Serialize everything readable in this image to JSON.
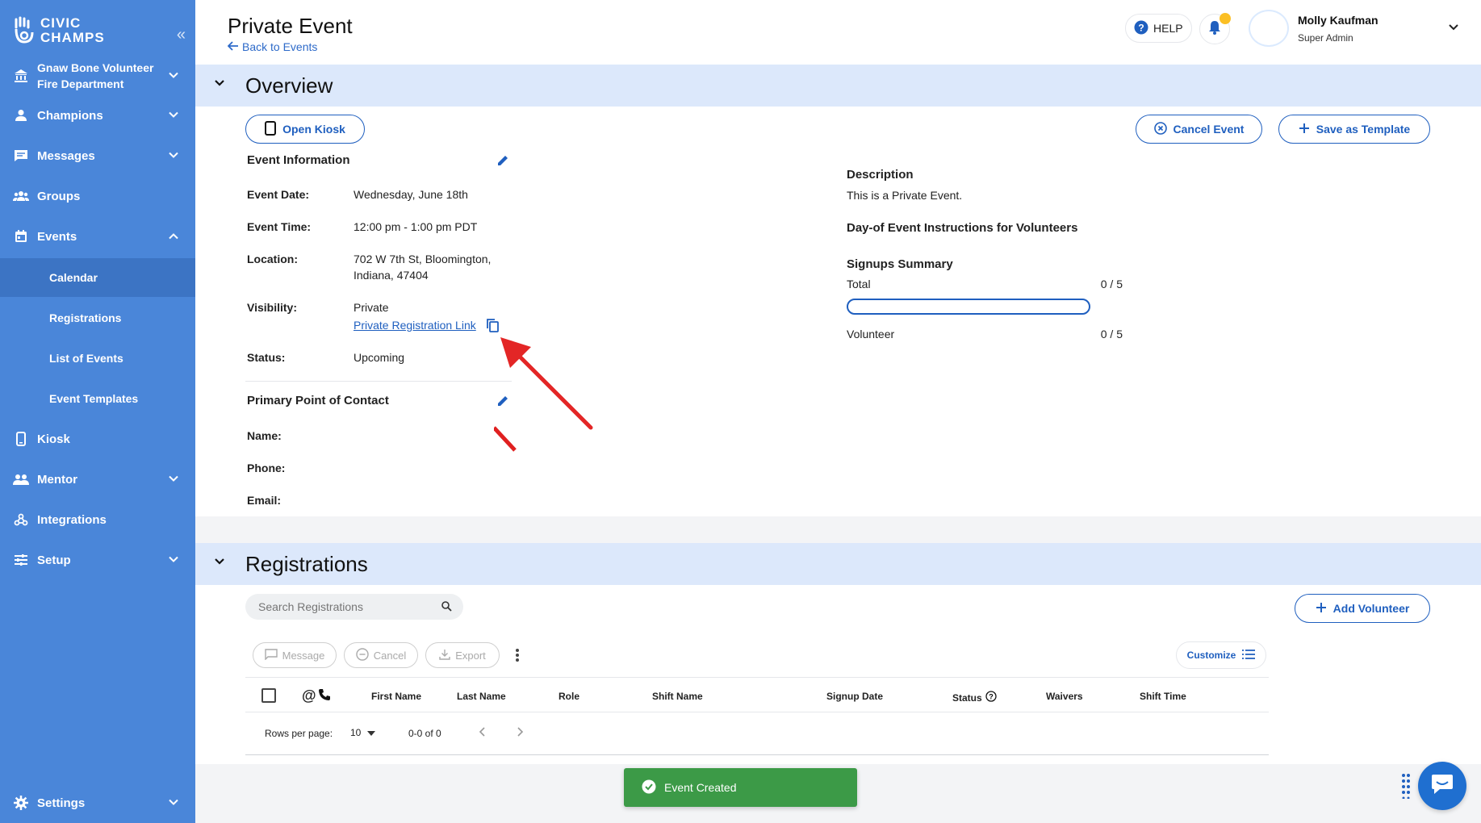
{
  "sidebar": {
    "logo_line1": "CIVIC",
    "logo_line2": "CHAMPS",
    "org_line1": "Gnaw Bone Volunteer",
    "org_line2": "Fire Department",
    "items": [
      {
        "label": "Champions",
        "icon": "person-icon"
      },
      {
        "label": "Messages",
        "icon": "message-icon"
      },
      {
        "label": "Groups",
        "icon": "groups-icon"
      },
      {
        "label": "Events",
        "icon": "calendar-icon"
      },
      {
        "label": "Kiosk",
        "icon": "tablet-icon"
      },
      {
        "label": "Mentor",
        "icon": "people-icon"
      },
      {
        "label": "Integrations",
        "icon": "integrations-icon"
      },
      {
        "label": "Setup",
        "icon": "sliders-icon"
      },
      {
        "label": "Settings",
        "icon": "gear-icon"
      }
    ],
    "event_subitems": [
      "Calendar",
      "Registrations",
      "List of Events",
      "Event Templates"
    ]
  },
  "header": {
    "title": "Private Event",
    "back_label": "Back to Events",
    "help_label": "HELP",
    "user_name": "Molly Kaufman",
    "user_role": "Super Admin"
  },
  "overview": {
    "title": "Overview",
    "open_kiosk": "Open Kiosk",
    "cancel_event": "Cancel Event",
    "save_template": "Save as Template",
    "event_info_title": "Event Information",
    "date_label": "Event Date:",
    "date_value": "Wednesday, June 18th",
    "time_label": "Event Time:",
    "time_value": "12:00 pm - 1:00 pm PDT",
    "location_label": "Location:",
    "location_line1": "702 W 7th St, Bloomington,",
    "location_line2": "Indiana, 47404",
    "visibility_label": "Visibility:",
    "visibility_value": "Private",
    "private_link": "Private Registration Link",
    "status_label": "Status:",
    "status_value": "Upcoming",
    "contact_title": "Primary Point of Contact",
    "name_label": "Name:",
    "phone_label": "Phone:",
    "email_label": "Email:",
    "description_title": "Description",
    "description_text": "This is a Private Event.",
    "instructions_title": "Day-of Event Instructions for Volunteers",
    "signups_title": "Signups Summary",
    "total_label": "Total",
    "total_value": "0 / 5",
    "total_progress": 0,
    "volunteer_label": "Volunteer",
    "volunteer_value": "0 / 5"
  },
  "registrations": {
    "title": "Registrations",
    "search_placeholder": "Search Registrations",
    "add_volunteer": "Add Volunteer",
    "message_btn": "Message",
    "cancel_btn": "Cancel",
    "export_btn": "Export",
    "customize_btn": "Customize",
    "columns": [
      "First Name",
      "Last Name",
      "Role",
      "Shift Name",
      "Signup Date",
      "Status",
      "Waivers",
      "Shift Time"
    ],
    "rows_per_page_label": "Rows per page:",
    "rows_per_page_value": "10",
    "range": "0-0 of 0"
  },
  "toast": {
    "message": "Event Created"
  },
  "colors": {
    "sidebar": "#4a86d9",
    "accent": "#1f5fbf",
    "band": "#dce8fb",
    "toast": "#3c9a47"
  }
}
